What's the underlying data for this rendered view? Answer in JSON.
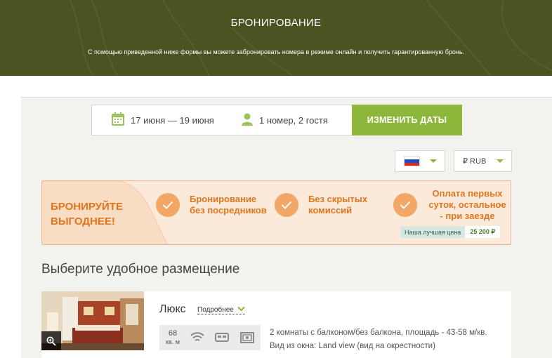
{
  "header": {
    "title": "БРОНИРОВАНИЕ",
    "subtitle": "С помощью приведенной ниже формы вы можете забронировать номера в режиме онлайн и получить гарантированную бронь."
  },
  "search": {
    "dates": "17 июня — 19 июня",
    "guests": "1 номер, 2 гостя",
    "change_button": "ИЗМЕНИТЬ ДАТЫ"
  },
  "selectors": {
    "language_flag": "russia-flag-icon",
    "currency": "₽ RUB"
  },
  "promo": {
    "title": "БРОНИРУЙТЕ ВЫГОДНЕЕ!",
    "features": [
      "Бронирование без посредников",
      "Без скрытых комиссий",
      "Оплата первых суток, остальное - при заезде"
    ],
    "best_price_label": "Наша лучшая цена",
    "best_price_value": "25 200 ₽"
  },
  "section_title": "Выберите удобное размещение",
  "room": {
    "name": "Люкс",
    "more_link": "Подробнее",
    "area_value": "68",
    "area_unit": "кв. м",
    "amenity_icons": [
      "wifi-icon",
      "bed-icon",
      "safe-icon"
    ],
    "description": "2 комнаты с балконом/без балкона, площадь - 43-58 м/кв. Вид из окна: Land view (вид на окрестности)"
  },
  "colors": {
    "header_bg": "#4a5322",
    "accent_green": "#8db73a",
    "promo_orange": "#e0761f",
    "promo_bg": "#fbe9d9"
  }
}
